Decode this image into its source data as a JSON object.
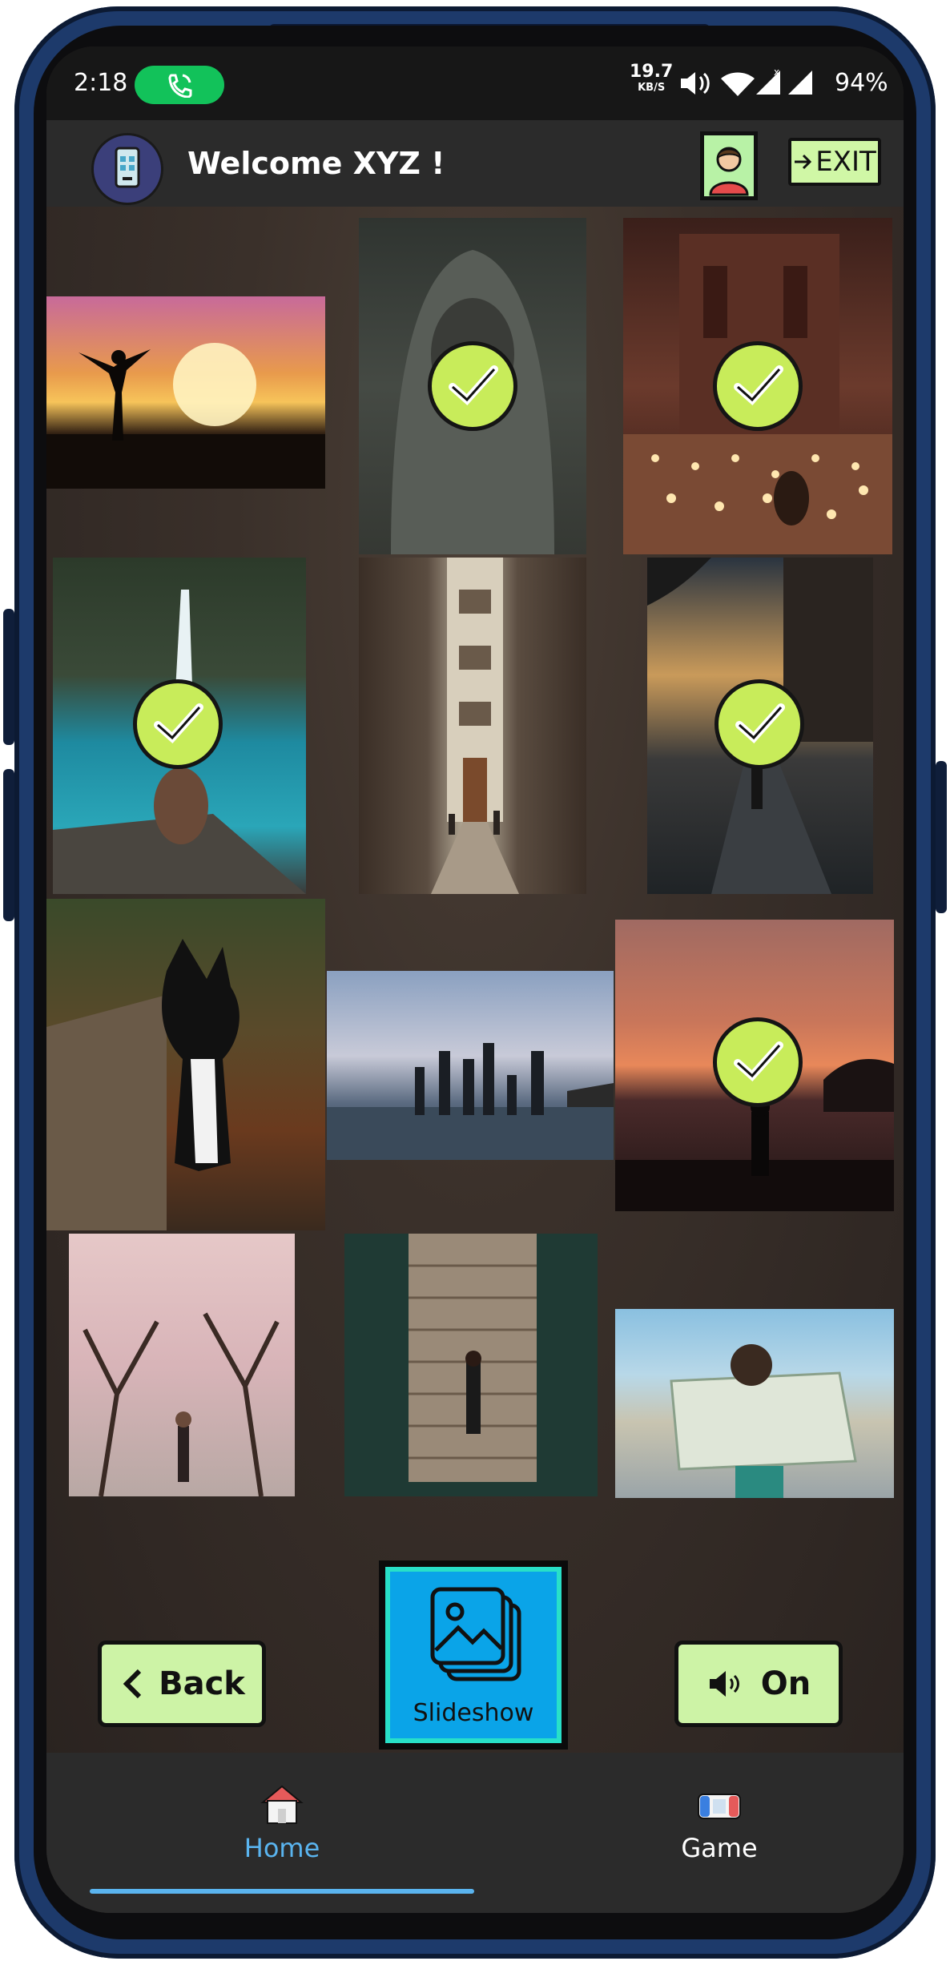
{
  "statusbar": {
    "time": "2:18",
    "net_speed_value": "19.7",
    "net_speed_unit": "KB/S",
    "battery": "94%"
  },
  "appbar": {
    "title": "Welcome XYZ !",
    "exit_label": "EXIT"
  },
  "gallery": {
    "photos": [
      {
        "subject": "sunset-silhouette",
        "selected": false
      },
      {
        "subject": "hooded-person",
        "selected": true
      },
      {
        "subject": "petra-candles",
        "selected": true
      },
      {
        "subject": "waterfall-sitter",
        "selected": true
      },
      {
        "subject": "alley-street",
        "selected": false
      },
      {
        "subject": "city-street-walker",
        "selected": true
      },
      {
        "subject": "dog-on-bench",
        "selected": false
      },
      {
        "subject": "beach-friends",
        "selected": false
      },
      {
        "subject": "sunset-beach-person",
        "selected": true
      },
      {
        "subject": "cherry-blossom-path",
        "selected": false
      },
      {
        "subject": "dock-lying-person",
        "selected": false
      },
      {
        "subject": "map-reader",
        "selected": false
      }
    ]
  },
  "controls": {
    "back_label": "Back",
    "sound_label": "On",
    "slideshow_label": "Slideshow"
  },
  "bottom_nav": {
    "items": [
      {
        "label": "Home",
        "icon": "home-icon",
        "active": true
      },
      {
        "label": "Game",
        "icon": "game-controller-icon",
        "active": false
      }
    ],
    "active_color": "#5ab4ef",
    "inactive_color": "#ffffff"
  },
  "colors": {
    "accent_green": "#c8ec5a",
    "button_green": "#cdf3a6",
    "slideshow_blue": "#0aa4e8",
    "call_green": "#12c25a"
  }
}
